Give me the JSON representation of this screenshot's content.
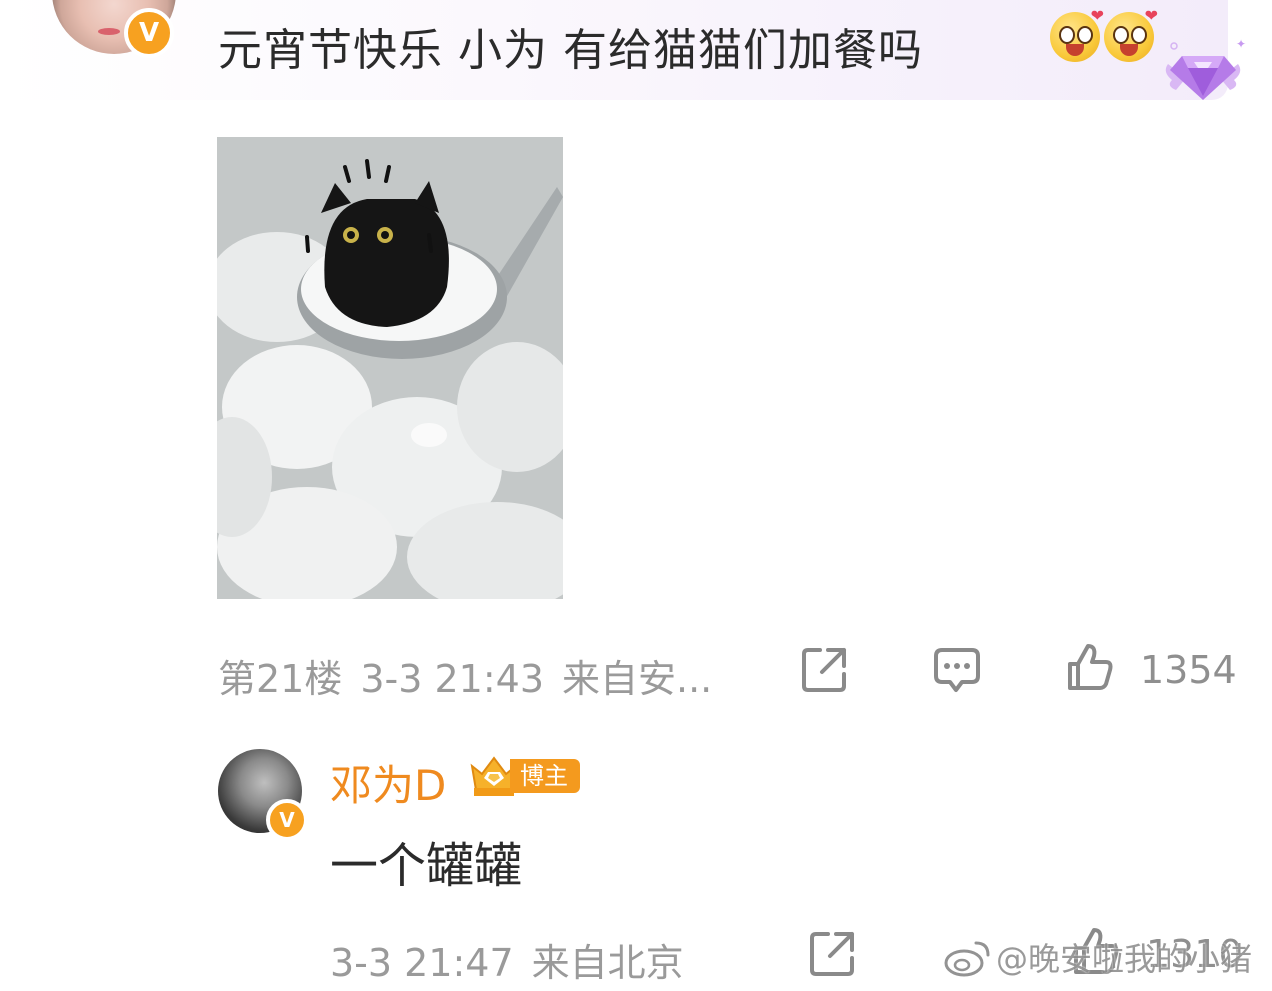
{
  "comment": {
    "text": "元宵节快乐 小为 有给猫猫们加餐吗",
    "emojis": [
      "excited-face-emoji",
      "excited-face-emoji"
    ],
    "badge_icon": "purple-diamond-badge-icon",
    "image_alt": "black cat on a spoon of tangyuan",
    "meta": {
      "floor": "第21楼",
      "time": "3-3 21:43",
      "source": "来自安..."
    },
    "like_count": "1354"
  },
  "reply": {
    "username": "邓为D",
    "role_badge": "博主",
    "text": "一个罐罐",
    "meta": {
      "time": "3-3 21:47",
      "source": "来自北京"
    },
    "like_count": "1310"
  },
  "watermark": "@晚安啦我的小猪",
  "colors": {
    "username": "#ef8a1f",
    "verified_badge": "#f7a120",
    "meta_text": "#9a9a9a",
    "body_text": "#2b2b2b"
  }
}
